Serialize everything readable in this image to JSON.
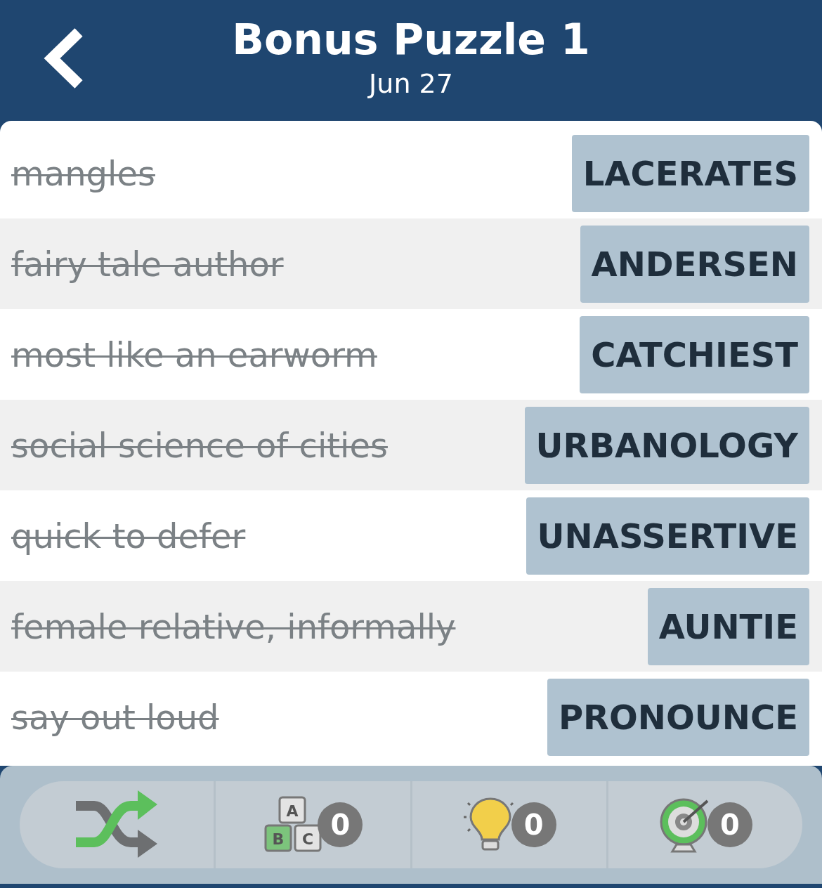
{
  "header": {
    "title": "Bonus Puzzle 1",
    "date": "Jun 27"
  },
  "clues": [
    {
      "clue": "mangles",
      "answer": "LACERATES",
      "solved": true
    },
    {
      "clue": "fairy tale author",
      "answer": "ANDERSEN",
      "solved": true
    },
    {
      "clue": "most like an earworm",
      "answer": "CATCHIEST",
      "solved": true
    },
    {
      "clue": "social science of cities",
      "answer": "URBANOLOGY",
      "solved": true
    },
    {
      "clue": "quick to defer",
      "answer": "UNASSERTIVE",
      "solved": true
    },
    {
      "clue": "female relative, informally",
      "answer": "AUNTIE",
      "solved": true
    },
    {
      "clue": "say out loud",
      "answer": "PRONOUNCE",
      "solved": true
    }
  ],
  "tools": [
    {
      "kind": "shuffle"
    },
    {
      "kind": "letters",
      "count": "0",
      "letters": [
        "A",
        "B",
        "C"
      ]
    },
    {
      "kind": "hint",
      "count": "0"
    },
    {
      "kind": "target",
      "count": "0"
    }
  ]
}
